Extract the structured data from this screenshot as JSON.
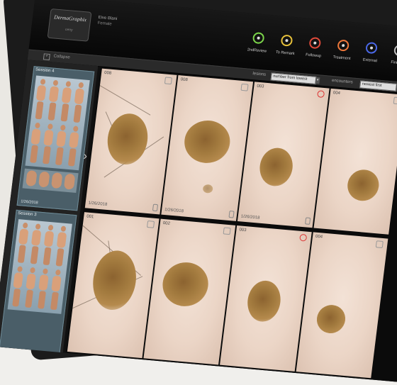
{
  "app": {
    "logo_text": "DermaGraphix",
    "logo_subtext": "ceny"
  },
  "patient": {
    "name": "Eive Blani",
    "sex": "Female"
  },
  "statuses": [
    {
      "label": "2ndReview",
      "color": "#7bd44a"
    },
    {
      "label": "To Remark",
      "color": "#e8c23a"
    },
    {
      "label": "Followup",
      "color": "#e14a3a"
    },
    {
      "label": "Treatment",
      "color": "#f0783a"
    },
    {
      "label": "External",
      "color": "#4a68e8"
    },
    {
      "label": "Finished",
      "color": "#bdbdbd"
    }
  ],
  "toolbar": {
    "collapse_label": "Collapse",
    "lesions_label": "lesions",
    "lesions_value": "number from lowest",
    "encounters_label": "encounters",
    "encounters_value": "newest first"
  },
  "sessions": [
    {
      "title": "Session 4",
      "date": "1/26/2018"
    },
    {
      "title": "Session 3",
      "date": ""
    }
  ],
  "cells": [
    {
      "number": "008",
      "date": "1/26/2018"
    },
    {
      "number": "008",
      "date": "1/26/2018"
    },
    {
      "number": "003",
      "date": "1/26/2018"
    },
    {
      "number": "004",
      "date": ""
    },
    {
      "number": "001",
      "date": ""
    },
    {
      "number": "002",
      "date": ""
    },
    {
      "number": "003",
      "date": ""
    },
    {
      "number": "004",
      "date": ""
    }
  ]
}
